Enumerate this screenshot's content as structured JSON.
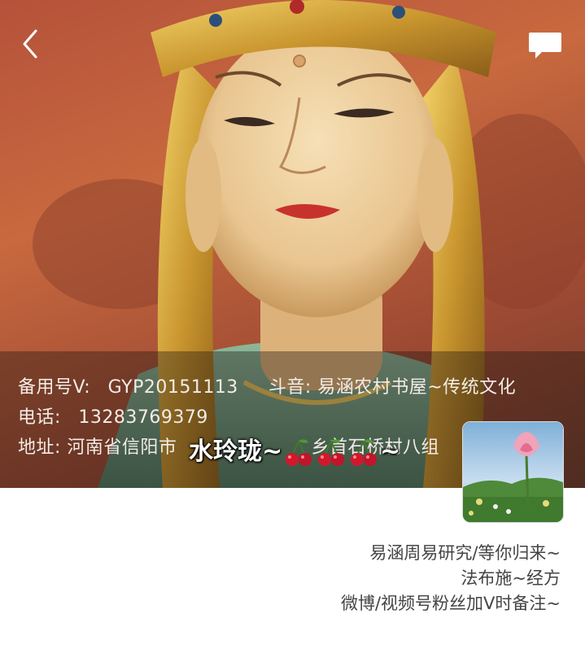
{
  "header": {
    "back_icon": "chevron-left-icon",
    "chat_icon": "chat-bubble-icon"
  },
  "cover": {
    "description_icon": "bodhisattva-statue-image",
    "info_lines": {
      "backup_label": "备用号V:",
      "backup_value": "GYP20151113",
      "douyin_label": "斗音:",
      "douyin_value": "易涵农村书屋~传统文化",
      "phone_label": "电话:",
      "phone_value": "13283769379",
      "address_label": "地址:",
      "address_value": "河南省信阳市",
      "address_tail": "乡首石桥村八组"
    }
  },
  "profile": {
    "nickname_prefix": "水玲珑~",
    "nickname_suffix": "~",
    "avatar_icon": "lotus-flower-avatar",
    "bio": [
      "易涵周易研究/等你归来~",
      "法布施~经方",
      "微博/视频号粉丝加V时备注~"
    ]
  },
  "colors": {
    "cover_base": "#b5523a",
    "overlay": "#1e140f",
    "bio_text": "#444444"
  }
}
